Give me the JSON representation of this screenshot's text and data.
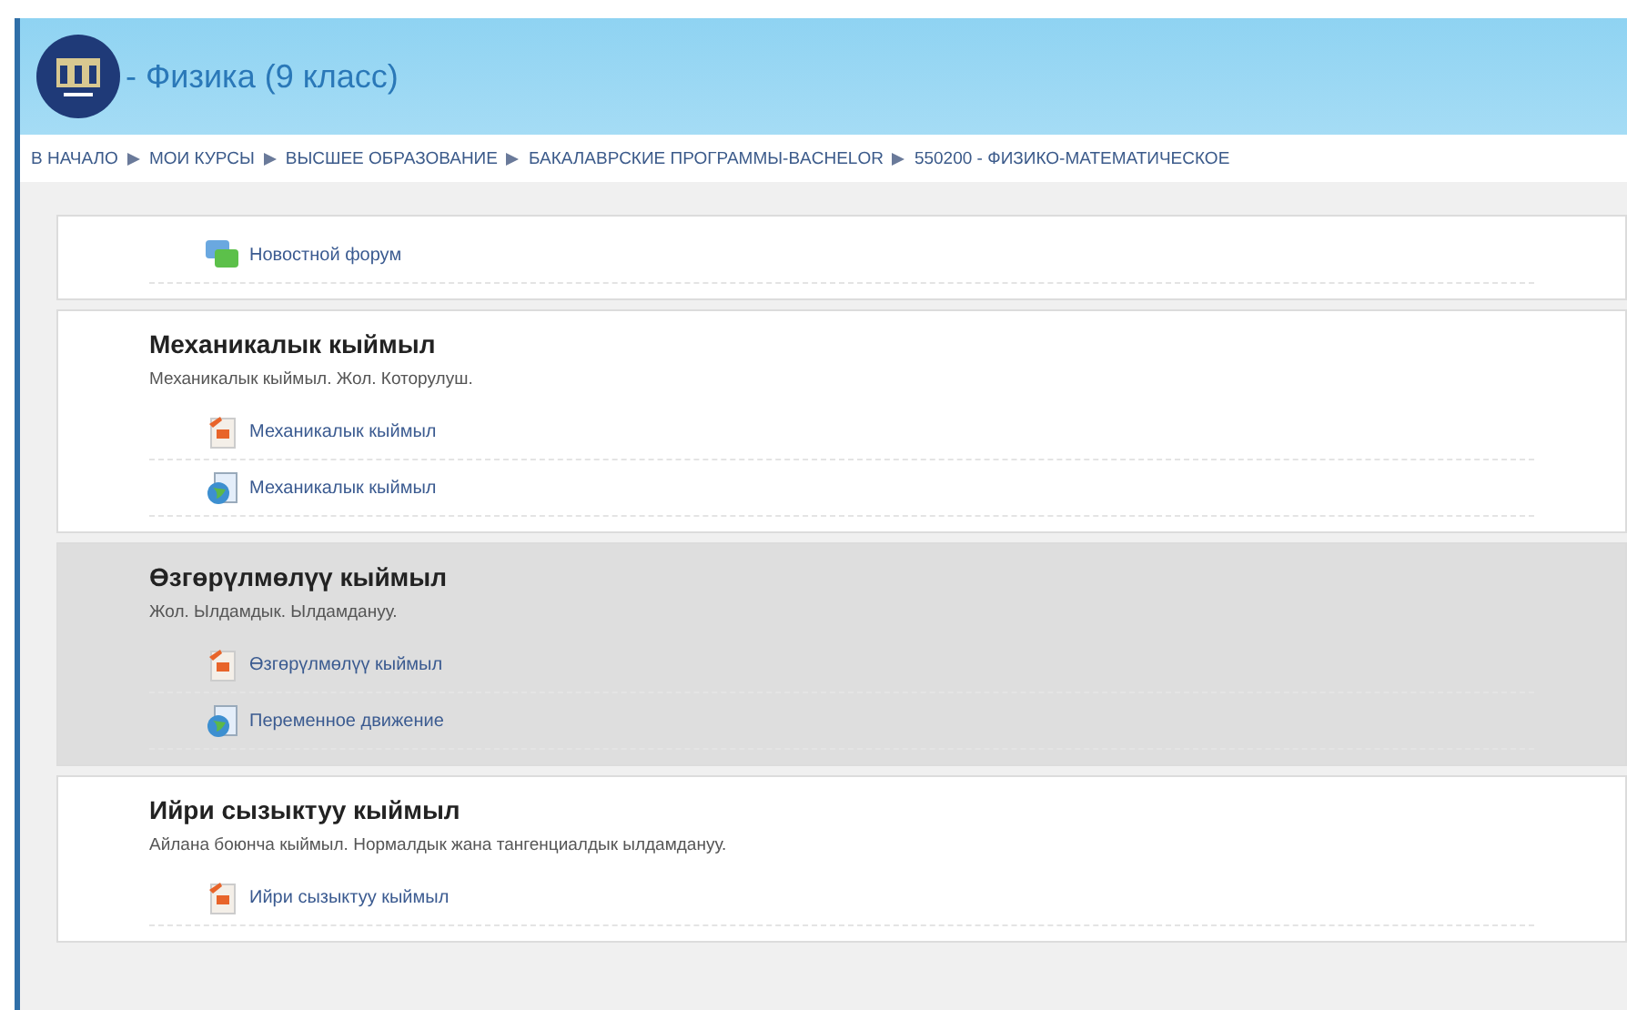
{
  "header": {
    "title": "- Физика (9 класс)"
  },
  "breadcrumb": [
    "В НАЧАЛО",
    "МОИ КУРСЫ",
    "ВЫСШЕЕ ОБРАЗОВАНИЕ",
    "БАКАЛАВРСКИЕ ПРОГРАММЫ-BACHELOR",
    "550200 - ФИЗИКО-МАТЕМАТИЧЕСКОЕ"
  ],
  "sections": [
    {
      "current": false,
      "activities": [
        {
          "kind": "forum",
          "label": "Новостной форум"
        }
      ]
    },
    {
      "current": false,
      "title": "Механикалык кыймыл",
      "summary": "Механикалык кыймыл. Жол. Которулуш.",
      "activities": [
        {
          "kind": "file",
          "label": "Механикалык кыймыл"
        },
        {
          "kind": "url",
          "label": "Механикалык кыймыл"
        }
      ]
    },
    {
      "current": true,
      "title": "Өзгөрүлмөлүү кыймыл",
      "summary": "Жол. Ылдамдык. Ылдамдануу.",
      "activities": [
        {
          "kind": "file",
          "label": "Өзгөрүлмөлүү кыймыл"
        },
        {
          "kind": "url",
          "label": "Переменное движение"
        }
      ]
    },
    {
      "current": false,
      "title": "Ийри сызыктуу кыймыл",
      "summary": "Айлана боюнча кыймыл. Нормалдык жана тангенциалдык ылдамдануу.",
      "activities": [
        {
          "kind": "file",
          "label": "Ийри сызыктуу кыймыл"
        }
      ]
    }
  ]
}
